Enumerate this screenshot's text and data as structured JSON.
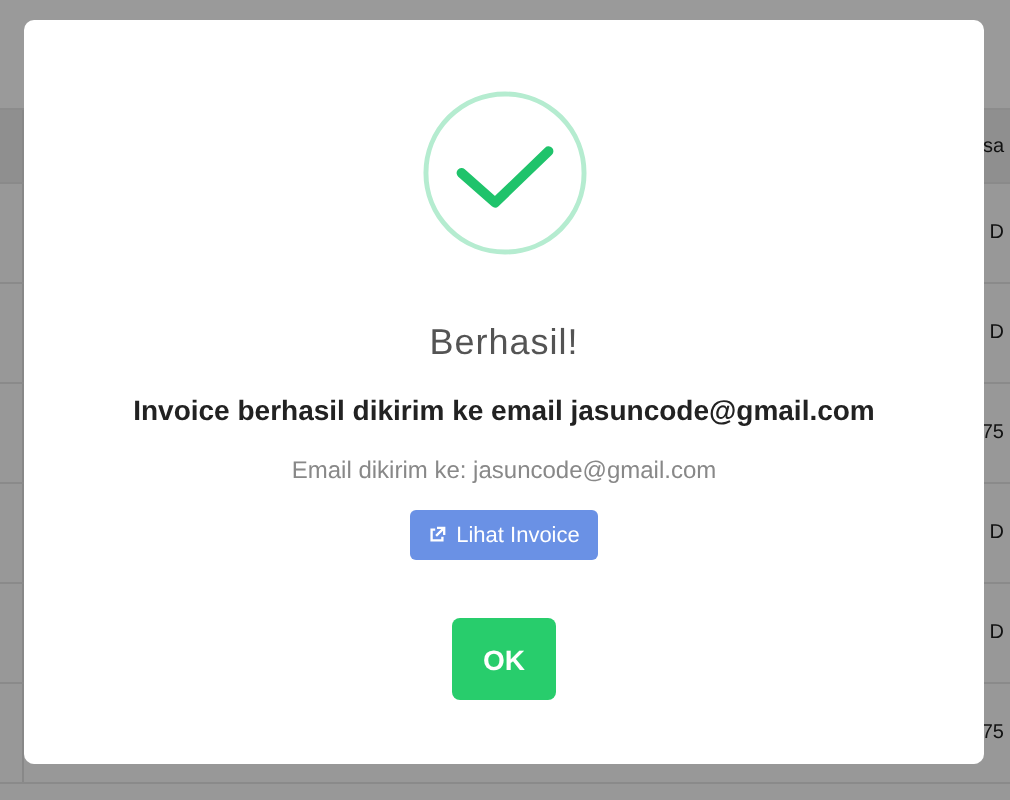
{
  "table": {
    "header_cell": "sa",
    "rows": [
      "D",
      "D",
      "75",
      "D",
      "D",
      "75"
    ]
  },
  "dialog": {
    "title": "Berhasil!",
    "message": "Invoice berhasil dikirim ke email jasuncode@gmail.com",
    "detail": "Email dikirim ke: jasuncode@gmail.com",
    "link_button": "Lihat Invoice",
    "confirm_button": "OK"
  }
}
